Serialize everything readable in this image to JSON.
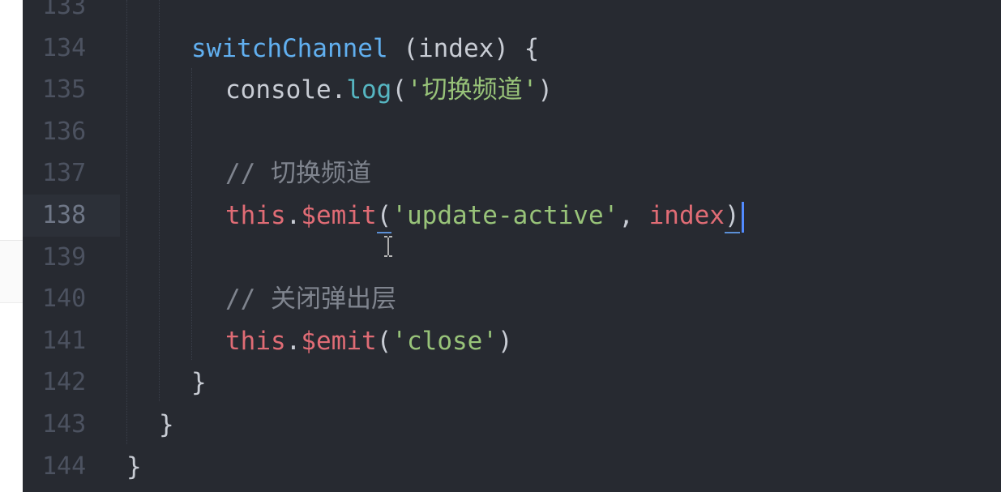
{
  "editor": {
    "theme_background": "#272a31",
    "lines": [
      {
        "number": "133",
        "tokens": []
      },
      {
        "number": "134",
        "tokens": [
          {
            "cls": "tok-fn",
            "text": "switchChannel"
          },
          {
            "cls": "tok-plain",
            "text": " (index) {"
          }
        ]
      },
      {
        "number": "135",
        "tokens": [
          {
            "cls": "tok-plain",
            "text": "console."
          },
          {
            "cls": "tok-method",
            "text": "log"
          },
          {
            "cls": "tok-plain",
            "text": "("
          },
          {
            "cls": "tok-str",
            "text": "'切换频道'"
          },
          {
            "cls": "tok-plain",
            "text": ")"
          }
        ]
      },
      {
        "number": "136",
        "tokens": []
      },
      {
        "number": "137",
        "tokens": [
          {
            "cls": "tok-comment",
            "text": "// 切换频道"
          }
        ]
      },
      {
        "number": "138",
        "tokens": [
          {
            "cls": "tok-kw",
            "text": "this"
          },
          {
            "cls": "tok-plain",
            "text": "."
          },
          {
            "cls": "tok-kw",
            "text": "$emit"
          },
          {
            "cls": "tok-plain",
            "text": "(",
            "underline": true
          },
          {
            "cls": "tok-str",
            "text": "'update-active'"
          },
          {
            "cls": "tok-plain",
            "text": ", "
          },
          {
            "cls": "tok-kw",
            "text": "index"
          },
          {
            "cls": "tok-plain",
            "text": ")",
            "underline": true
          }
        ]
      },
      {
        "number": "139",
        "tokens": []
      },
      {
        "number": "140",
        "tokens": [
          {
            "cls": "tok-comment",
            "text": "// 关闭弹出层"
          }
        ]
      },
      {
        "number": "141",
        "tokens": [
          {
            "cls": "tok-kw",
            "text": "this"
          },
          {
            "cls": "tok-plain",
            "text": "."
          },
          {
            "cls": "tok-kw",
            "text": "$emit"
          },
          {
            "cls": "tok-plain",
            "text": "("
          },
          {
            "cls": "tok-str",
            "text": "'close'"
          },
          {
            "cls": "tok-plain",
            "text": ")"
          }
        ]
      },
      {
        "number": "142",
        "tokens": [
          {
            "cls": "tok-brace",
            "text": "}"
          }
        ]
      },
      {
        "number": "143",
        "tokens": [
          {
            "cls": "tok-brace",
            "text": "}"
          }
        ]
      },
      {
        "number": "144",
        "tokens": [
          {
            "cls": "tok-brace",
            "text": "}"
          }
        ]
      }
    ],
    "active_line": "138"
  }
}
